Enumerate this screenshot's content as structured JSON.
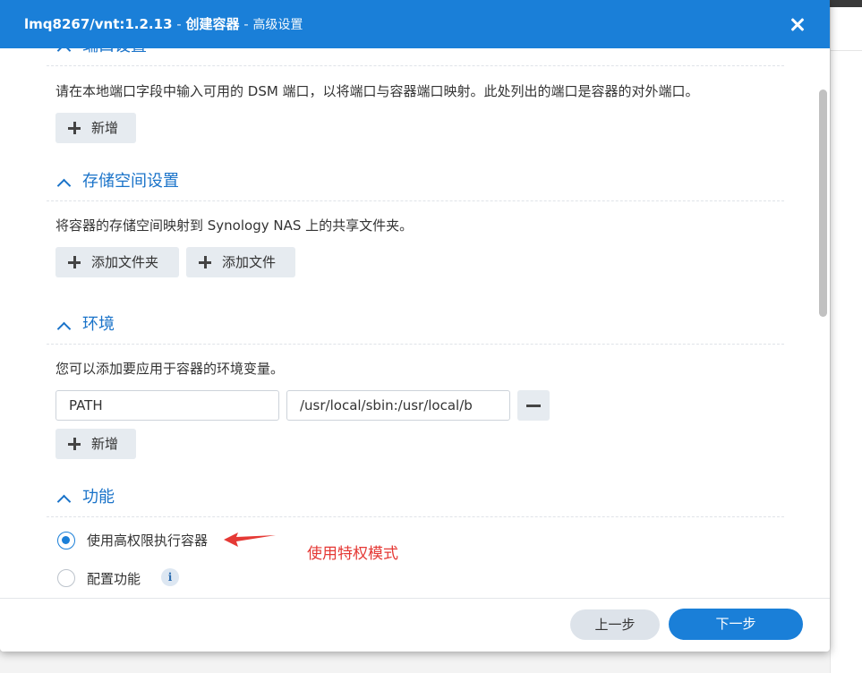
{
  "window": {
    "title_main": "lmq8267/vnt:1.2.13",
    "title_sep": " - ",
    "title_wizard": "创建容器",
    "title_sub": "高级设置"
  },
  "sections": {
    "port": {
      "title": "端口设置",
      "description": "请在本地端口字段中输入可用的 DSM 端口，以将端口与容器端口映射。此处列出的端口是容器的对外端口。",
      "add_label": "新增"
    },
    "storage": {
      "title": "存储空间设置",
      "description": "将容器的存储空间映射到 Synology NAS 上的共享文件夹。",
      "add_folder_label": "添加文件夹",
      "add_file_label": "添加文件"
    },
    "env": {
      "title": "环境",
      "description": "您可以添加要应用于容器的环境变量。",
      "var_name": "PATH",
      "var_value": "/usr/local/sbin:/usr/local/b",
      "add_label": "新增"
    },
    "capability": {
      "title": "功能",
      "options": [
        {
          "label": "使用高权限执行容器",
          "checked": true
        },
        {
          "label": "配置功能",
          "checked": false
        }
      ],
      "info_glyph": "i"
    }
  },
  "annotation": {
    "text": "使用特权模式",
    "color": "#e53935"
  },
  "footer": {
    "prev_label": "上一步",
    "next_label": "下一步"
  },
  "colors": {
    "accent": "#1a7fd8",
    "section_title": "#1a73c9"
  }
}
